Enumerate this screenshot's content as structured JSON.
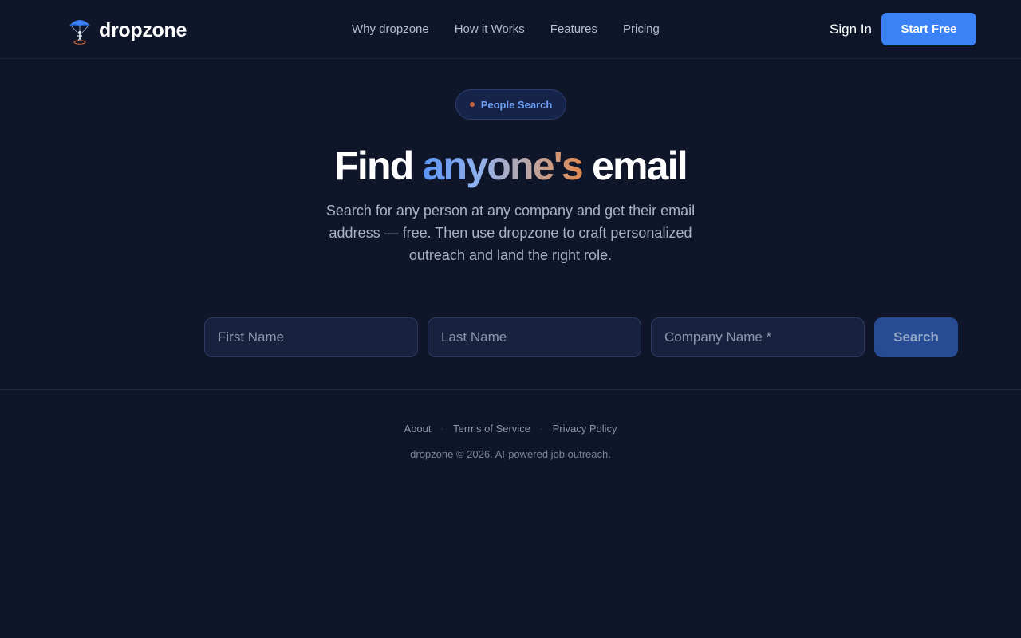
{
  "brand": {
    "name": "dropzone",
    "accent": "#3b82f6"
  },
  "nav": {
    "items": [
      {
        "label": "Why dropzone"
      },
      {
        "label": "How it Works"
      },
      {
        "label": "Features"
      },
      {
        "label": "Pricing"
      }
    ],
    "sign_in": "Sign In",
    "start_free": "Start Free"
  },
  "hero": {
    "badge": "People Search",
    "title_start": "Find ",
    "title_highlight": "anyone's",
    "title_end": " email",
    "subtitle": "Search for any person at any company and get their email address — free. Then use dropzone to craft personalized outreach and land the right role."
  },
  "search": {
    "first_name_placeholder": "First Name",
    "last_name_placeholder": "Last Name",
    "company_placeholder": "Company Name *",
    "button": "Search"
  },
  "footer": {
    "links": [
      {
        "label": "About"
      },
      {
        "label": "Terms of Service"
      },
      {
        "label": "Privacy Policy"
      }
    ],
    "separator": "·",
    "copyright": "dropzone © 2026. AI-powered job outreach."
  }
}
